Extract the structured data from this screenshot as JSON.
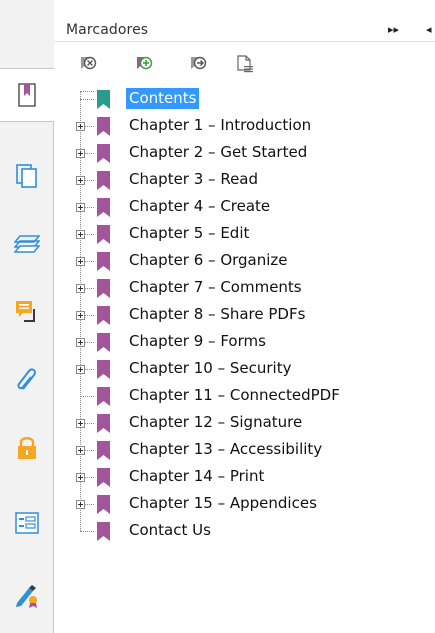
{
  "panel": {
    "title": "Marcadores",
    "collapse_glyph": "▸▸",
    "close_glyph": "◂"
  },
  "toolbar": [
    {
      "icon": "delete-bookmark-icon"
    },
    {
      "icon": "add-bookmark-icon"
    },
    {
      "icon": "add-child-bookmark-icon"
    },
    {
      "icon": "bookmark-options-icon"
    }
  ],
  "rail": [
    {
      "icon": "bookmarks-panel-icon",
      "active": true
    },
    {
      "icon": "page-thumbnails-icon"
    },
    {
      "icon": "layers-icon"
    },
    {
      "icon": "comments-icon"
    },
    {
      "icon": "attachments-icon"
    },
    {
      "icon": "security-lock-icon"
    },
    {
      "icon": "form-fields-icon"
    },
    {
      "icon": "digital-signature-icon"
    }
  ],
  "bookmarks": [
    {
      "label": "Contents",
      "expandable": false,
      "selected": true,
      "color": "#2a9c8e"
    },
    {
      "label": "Chapter 1 – Introduction",
      "expandable": true,
      "color": "#a3559c"
    },
    {
      "label": "Chapter 2 – Get Started",
      "expandable": true,
      "color": "#a3559c"
    },
    {
      "label": "Chapter 3 – Read",
      "expandable": true,
      "color": "#a3559c"
    },
    {
      "label": "Chapter 4 – Create",
      "expandable": true,
      "color": "#a3559c"
    },
    {
      "label": "Chapter 5 – Edit",
      "expandable": true,
      "color": "#a3559c"
    },
    {
      "label": "Chapter 6 – Organize",
      "expandable": true,
      "color": "#a3559c"
    },
    {
      "label": "Chapter 7 – Comments",
      "expandable": true,
      "color": "#a3559c"
    },
    {
      "label": "Chapter 8 – Share PDFs",
      "expandable": true,
      "color": "#a3559c"
    },
    {
      "label": "Chapter 9 – Forms",
      "expandable": true,
      "color": "#a3559c"
    },
    {
      "label": "Chapter 10 – Security",
      "expandable": true,
      "color": "#a3559c"
    },
    {
      "label": "Chapter 11 – ConnectedPDF",
      "expandable": false,
      "color": "#a3559c"
    },
    {
      "label": "Chapter 12 – Signature",
      "expandable": true,
      "color": "#a3559c"
    },
    {
      "label": "Chapter 13 – Accessibility",
      "expandable": true,
      "color": "#a3559c"
    },
    {
      "label": "Chapter 14 – Print",
      "expandable": true,
      "color": "#a3559c"
    },
    {
      "label": "Chapter 15 – Appendices",
      "expandable": true,
      "color": "#a3559c"
    },
    {
      "label": "Contact Us",
      "expandable": false,
      "color": "#a3559c"
    }
  ],
  "colors": {
    "selection": "#3399ff",
    "rail_icon_blue": "#2f8fd8",
    "rail_icon_orange": "#f5a623",
    "bookmark_purple": "#a3559c",
    "bookmark_teal": "#2a9c8e"
  }
}
